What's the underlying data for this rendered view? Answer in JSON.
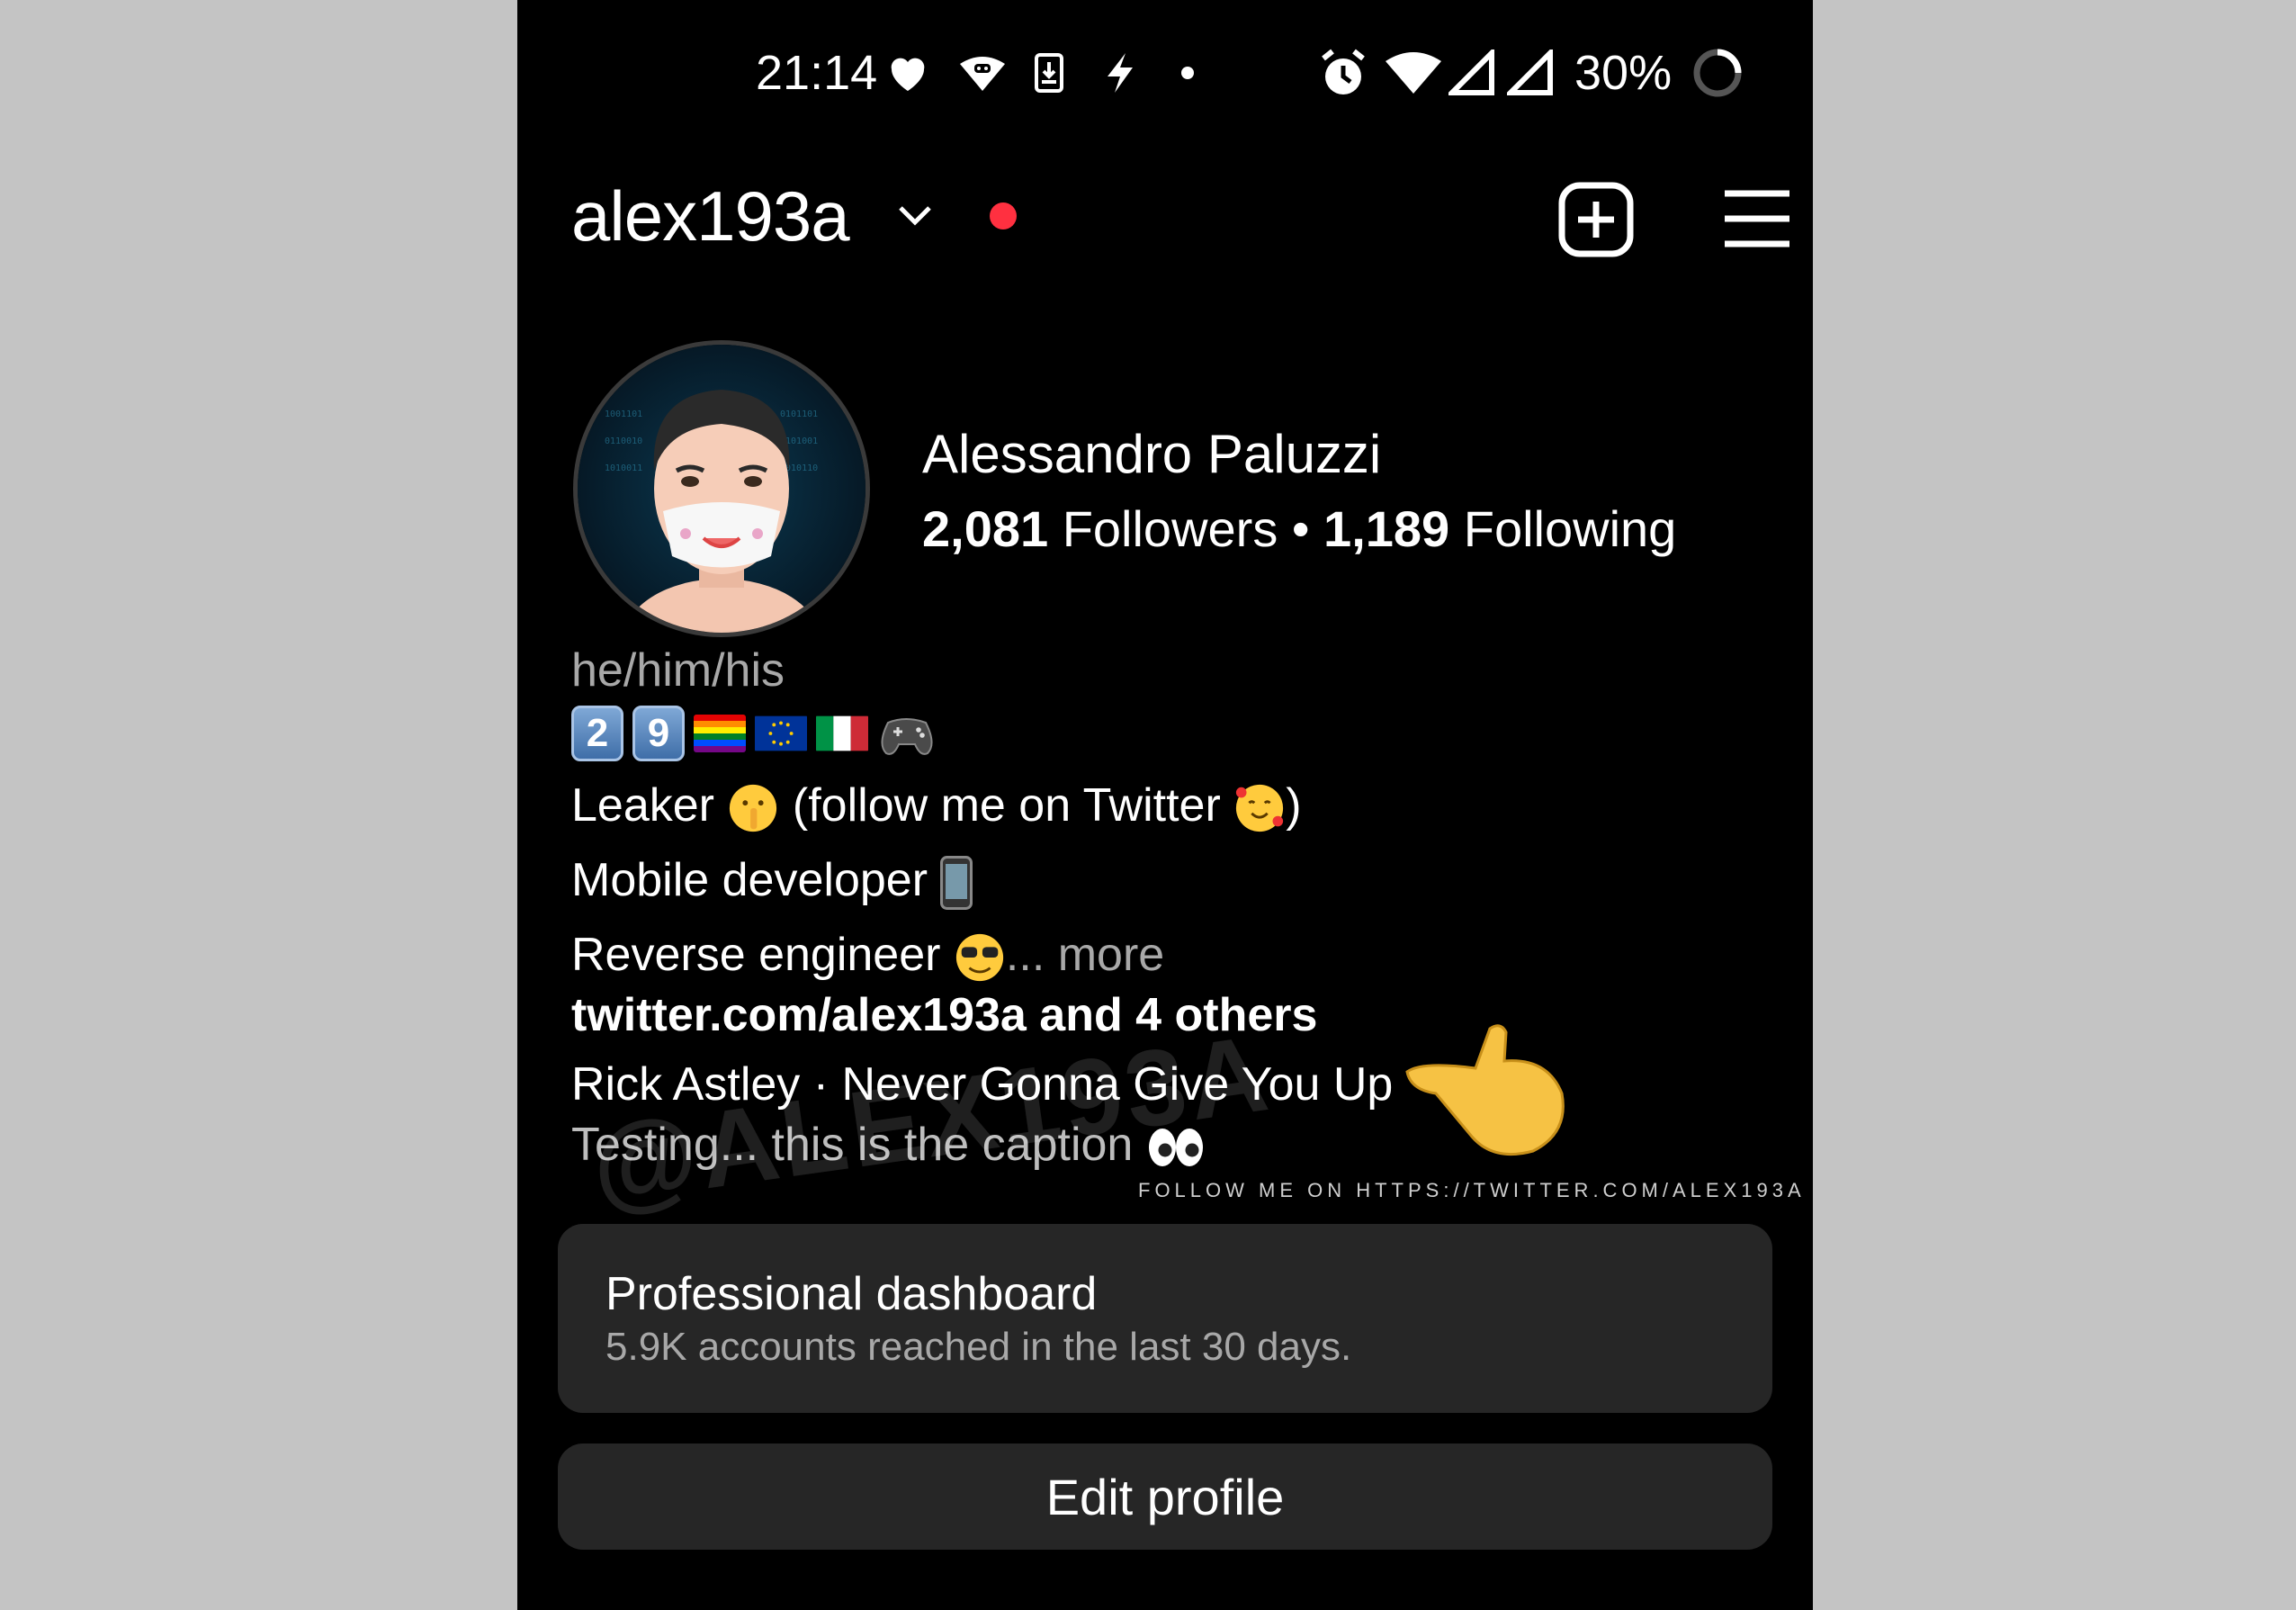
{
  "status_bar": {
    "time": "21:14",
    "battery": "30%",
    "icons": [
      "heart-icon",
      "android-icon",
      "download-icon",
      "bolt-icon",
      "dot-icon",
      "alarm-icon",
      "wifi-icon",
      "signal-icon",
      "signal-icon",
      "battery-ring-icon"
    ]
  },
  "header": {
    "username": "alex193a",
    "icons": [
      "chevron-down-icon",
      "notification-dot",
      "new-post-icon",
      "menu-icon"
    ]
  },
  "profile": {
    "display_name": "Alessandro Paluzzi",
    "followers_count": "2,081",
    "followers_label": " Followers",
    "separator": " • ",
    "following_count": "1,189",
    "following_label": " Following"
  },
  "bio": {
    "pronouns": "he/him/his",
    "age_digits": [
      "2",
      "9"
    ],
    "line1_a": "Leaker ",
    "line1_b": " (follow me on Twitter ",
    "line1_c": ")",
    "line2": "Mobile developer ",
    "line3": "Reverse engineer ",
    "more": "... more",
    "link": "twitter.com/alex193a and 4 others",
    "song": "Rick Astley · Never Gonna Give You Up",
    "caption": "Testing... this is the caption "
  },
  "watermark": {
    "small": "FOLLOW ME ON HTTPS://TWITTER.COM/ALEX193A",
    "big": "@ALEX193A"
  },
  "dashboard": {
    "title": "Professional dashboard",
    "subtitle": "5.9K accounts reached in the last 30 days."
  },
  "buttons": {
    "edit_profile": "Edit profile"
  },
  "colors": {
    "background": "#000000",
    "card": "#262626",
    "notification_dot": "#ff3040",
    "secondary_text": "#a8a8a8"
  }
}
